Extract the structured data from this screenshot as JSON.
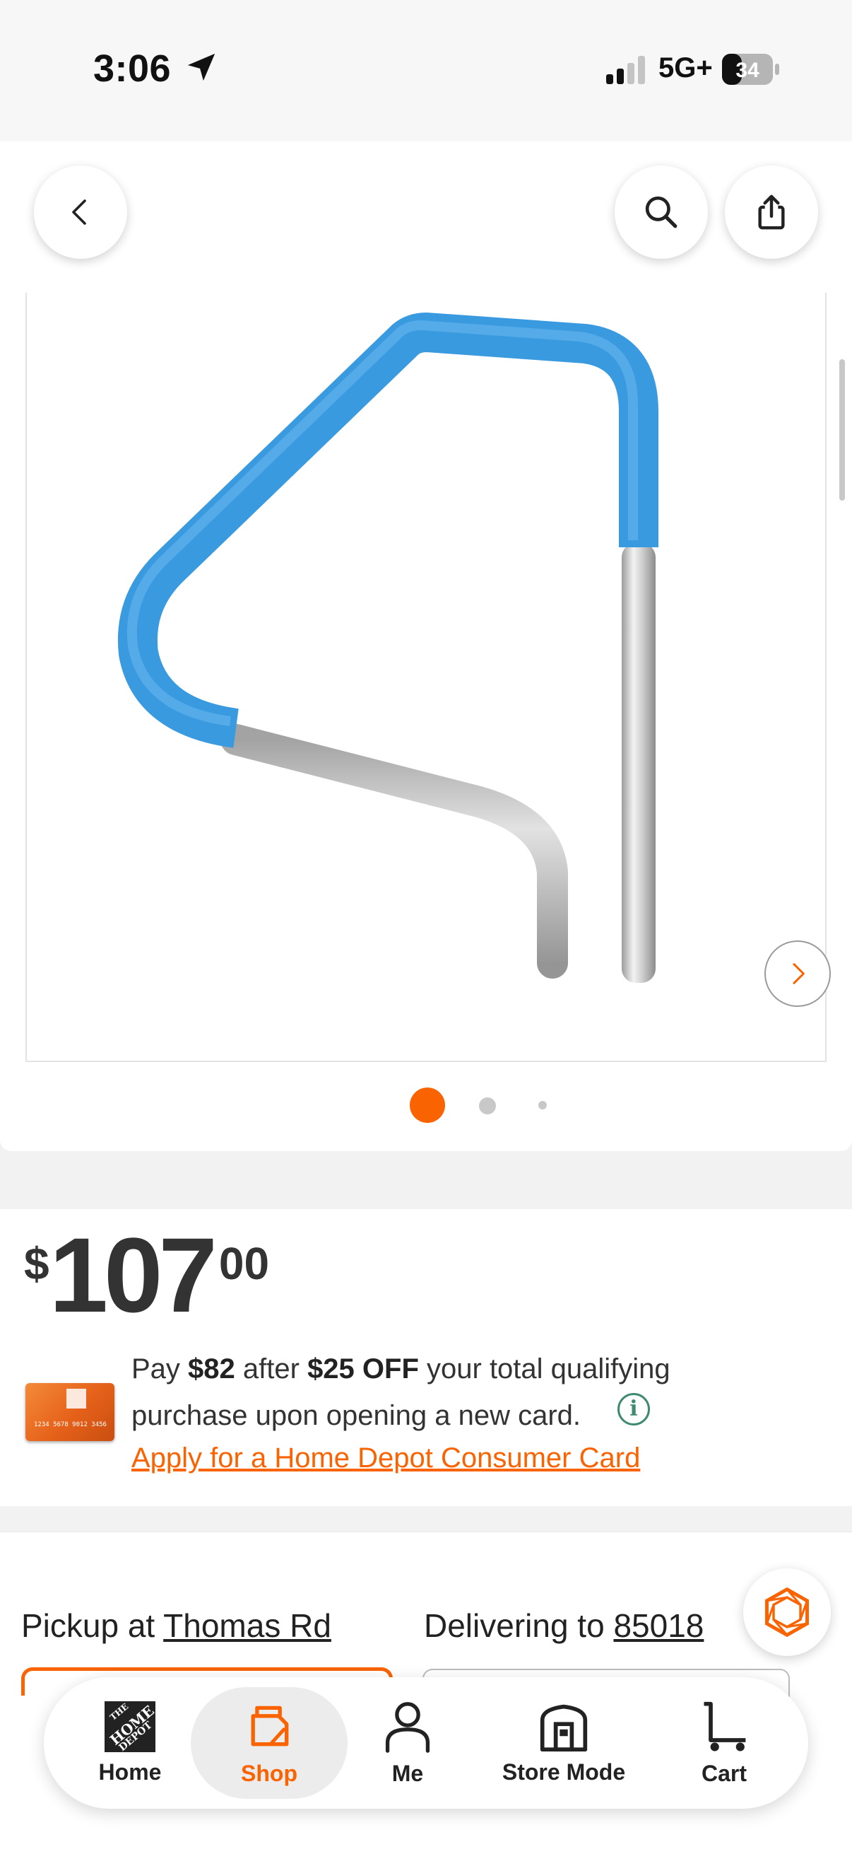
{
  "status_bar": {
    "time": "3:06",
    "network": "5G+",
    "battery": "34"
  },
  "header": {
    "back_label": "Back",
    "search_label": "Search",
    "share_label": "Share"
  },
  "gallery": {
    "page_count": 3,
    "active_index": 0
  },
  "price": {
    "currency": "$",
    "dollars": "107",
    "cents": "00"
  },
  "promo": {
    "pay_prefix": "Pay ",
    "pay_amount": "$82",
    "after_text": " after ",
    "off_amount": "$25 OFF",
    "line1_suffix": " your total qualifying",
    "line2": "purchase upon opening a new card.",
    "info_glyph": "i",
    "apply_link": "Apply for a Home Depot Consumer Card",
    "card_number": "1234 5678 9012 3456"
  },
  "fulfillment": {
    "pickup_prefix": "Pickup at ",
    "pickup_store": "Thomas Rd",
    "deliver_prefix": "Delivering to ",
    "deliver_zip": "85018"
  },
  "tabbar": {
    "items": [
      {
        "label": "Home",
        "icon": "home-depot-logo-icon"
      },
      {
        "label": "Shop",
        "icon": "shop-tag-icon",
        "active": true
      },
      {
        "label": "Me",
        "icon": "person-icon"
      },
      {
        "label": "Store Mode",
        "icon": "store-icon"
      },
      {
        "label": "Cart",
        "icon": "cart-icon"
      }
    ]
  },
  "colors": {
    "brand_orange": "#f96302",
    "info_green": "#3e8a6f",
    "rail_blue": "#3a9ae0"
  }
}
